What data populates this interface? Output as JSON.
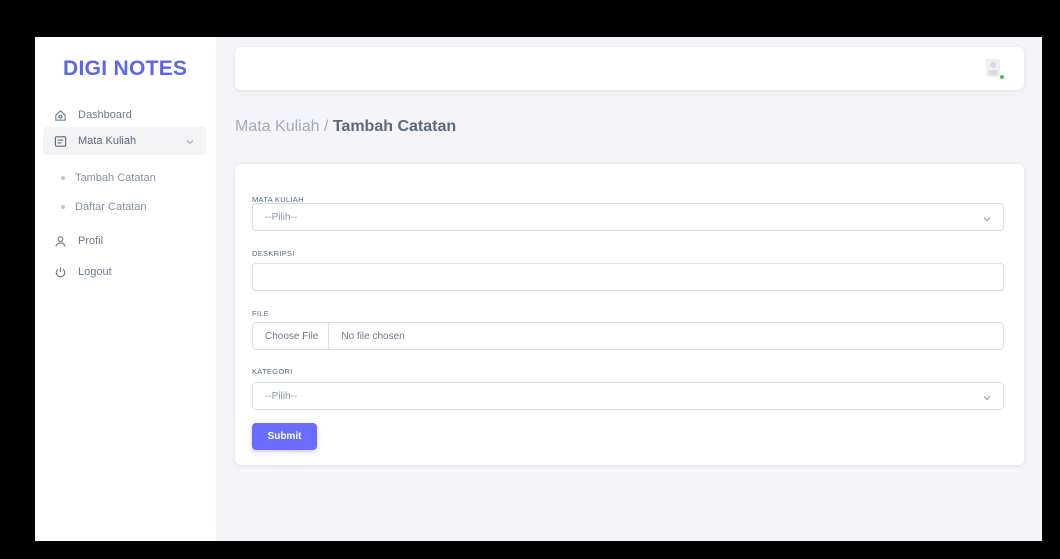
{
  "sidebar": {
    "brand": "DIGI NOTES",
    "items": [
      {
        "label": "Dashboard",
        "icon": "home-icon"
      },
      {
        "label": "Mata Kuliah",
        "icon": "list-icon"
      },
      {
        "label": "Profil",
        "icon": "user-icon"
      },
      {
        "label": "Logout",
        "icon": "power-icon"
      }
    ],
    "sub_items": [
      {
        "label": "Tambah Catatan"
      },
      {
        "label": "Daftar Catatan"
      }
    ]
  },
  "breadcrumb": {
    "parent": "Mata Kuliah /",
    "current": "Tambah Catatan"
  },
  "form": {
    "mata_kuliah": {
      "label": "MATA KULIAH",
      "value": "--Pilih--"
    },
    "deskripsi": {
      "label": "DESKRIPSI",
      "value": ""
    },
    "file": {
      "label": "FILE",
      "button": "Choose File",
      "status": "No file chosen"
    },
    "kategori": {
      "label": "KATEGORI",
      "value": "--Pilih--"
    },
    "submit_label": "Submit"
  },
  "colors": {
    "brand": "#5a67e8",
    "primary": "#696cff",
    "online": "#3fc35a",
    "background": "#f5f5f9"
  }
}
